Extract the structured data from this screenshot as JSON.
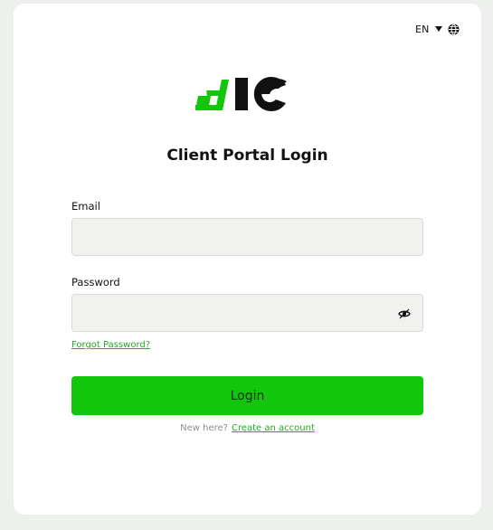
{
  "language": {
    "code": "EN",
    "caret_icon": "caret-down-icon",
    "globe_icon": "globe-icon"
  },
  "brand": {
    "logo_icon": "hc-logo-icon",
    "primary_color": "#11c60b",
    "link_color": "#1dae1d"
  },
  "page": {
    "title": "Client Portal Login"
  },
  "form": {
    "email": {
      "label": "Email",
      "value": "",
      "placeholder": ""
    },
    "password": {
      "label": "Password",
      "value": "",
      "placeholder": "",
      "toggle_icon": "eye-icon"
    },
    "forgot_label": "Forgot Password?",
    "login_label": "Login",
    "signup_prompt": "New here?",
    "signup_link": "Create an account"
  }
}
